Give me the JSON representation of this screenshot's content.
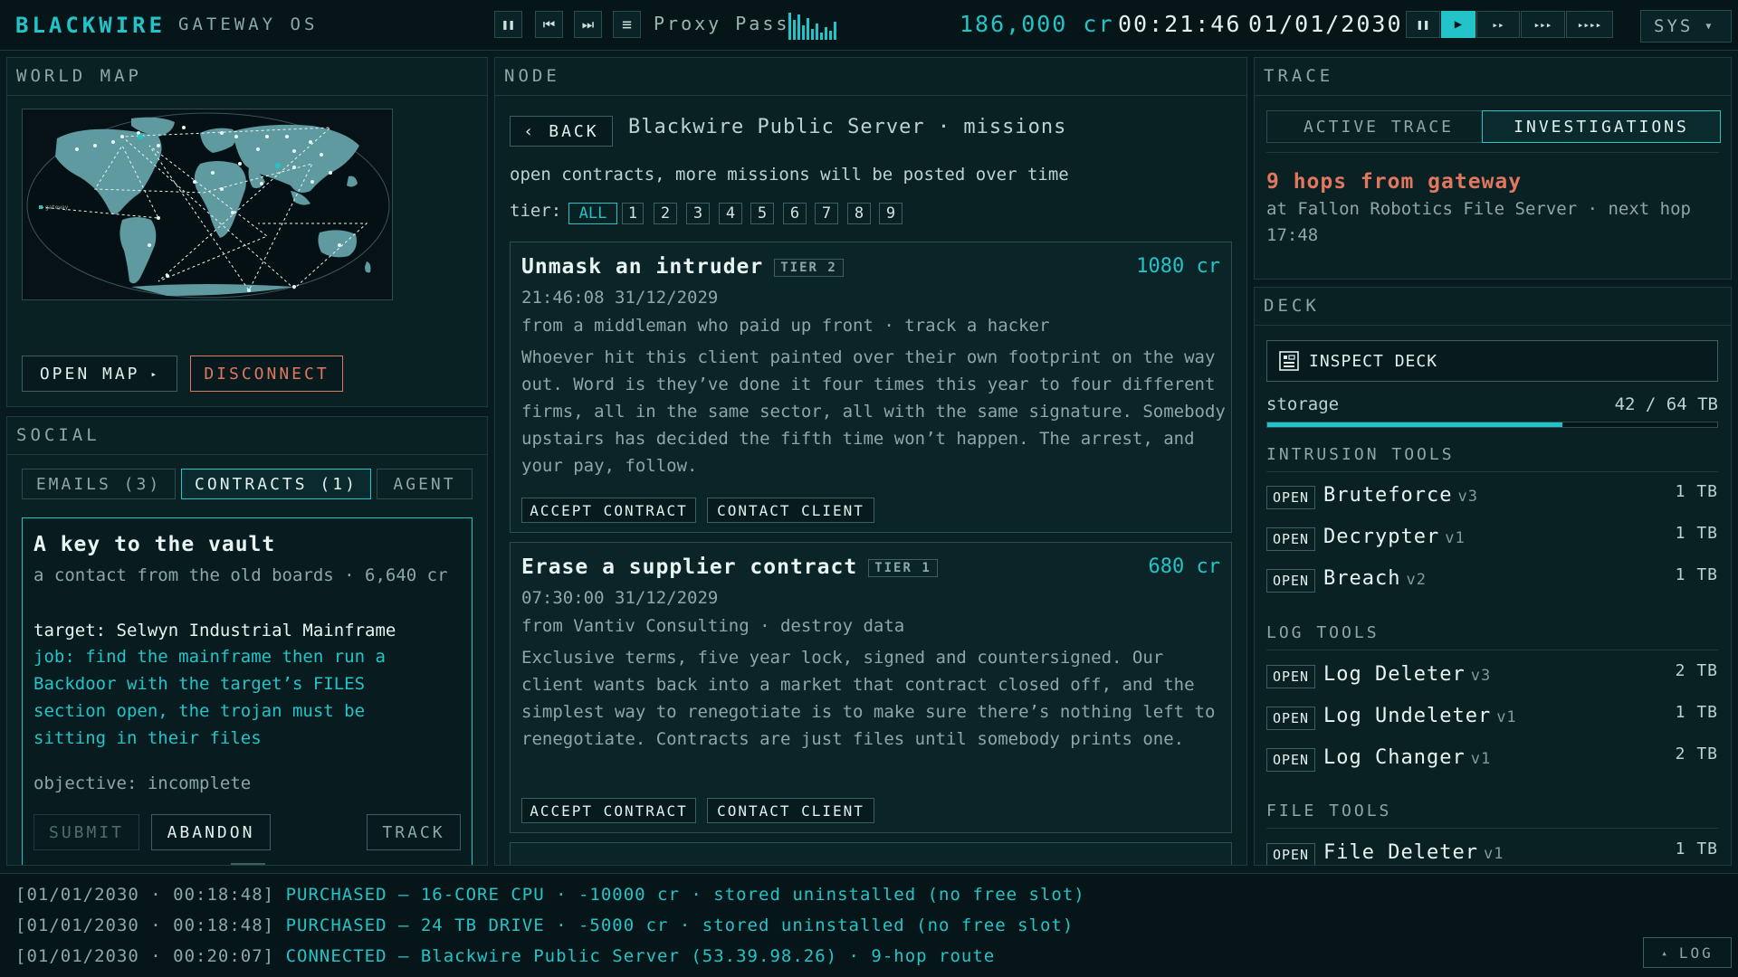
{
  "topbar": {
    "brand": "BLACKWIRE",
    "os": "GATEWAY OS",
    "music_controls": [
      {
        "icon": "pause-icon",
        "glyph": "❚❚"
      },
      {
        "icon": "skip-back-icon",
        "glyph": "⏮"
      },
      {
        "icon": "skip-forward-icon",
        "glyph": "⏭"
      },
      {
        "icon": "playlist-icon",
        "glyph": "≡"
      }
    ],
    "track": "Proxy Pass",
    "credits": "186,000 cr",
    "clock": "00:21:46",
    "date": "01/01/2030",
    "speed": [
      {
        "icon": "pause-icon",
        "glyph": "❚❚",
        "active": false
      },
      {
        "icon": "play-icon",
        "glyph": "▶",
        "active": true
      },
      {
        "icon": "fast-forward-icon",
        "glyph": "▸▸",
        "active": false
      },
      {
        "icon": "faster-icon",
        "glyph": "▸▸▸",
        "active": false
      },
      {
        "icon": "fastest-icon",
        "glyph": "▸▸▸▸",
        "active": false
      }
    ],
    "sys": "SYS"
  },
  "world_map": {
    "title": "WORLD MAP",
    "gateway_label": "gateway",
    "open_map": "OPEN MAP",
    "open_map_arrow": "▸",
    "disconnect": "DISCONNECT"
  },
  "social": {
    "title": "SOCIAL",
    "tabs": [
      "EMAILS (3)",
      "CONTRACTS (1)",
      "AGENT"
    ],
    "active_tab": 1,
    "contract": {
      "title": "A key to the vault",
      "from": "a contact from the old boards · 6,640 cr",
      "target": "target: Selwyn Industrial Mainframe",
      "job": "job: find the mainframe then run a Backdoor with the target’s FILES section open, the trojan must be sitting in their files",
      "objective": "objective: incomplete",
      "submit": "SUBMIT",
      "abandon": "ABANDON",
      "track": "TRACK"
    }
  },
  "node": {
    "title": "NODE",
    "back": "BACK",
    "back_icon": "‹",
    "server": "Blackwire Public Server · missions",
    "intro": "open contracts, more missions will be posted over time",
    "tier_label": "tier:",
    "tiers": [
      "ALL",
      "1",
      "2",
      "3",
      "4",
      "5",
      "6",
      "7",
      "8",
      "9"
    ],
    "missions": [
      {
        "title": "Unmask an intruder",
        "tier": "TIER 2",
        "reward": "1080 cr",
        "time": "21:46:08 31/12/2029",
        "from": "from a middleman who paid up front · track a hacker",
        "body": "Whoever hit this client painted over their own footprint on the way out. Word is they’ve done it four times this year to four different firms, all in the same sector, all with the same signature. Somebody upstairs has decided the fifth time won’t happen. The arrest, and your pay, follow.",
        "accept": "ACCEPT CONTRACT",
        "contact": "CONTACT CLIENT"
      },
      {
        "title": "Erase a supplier contract",
        "tier": "TIER 1",
        "reward": "680 cr",
        "time": "07:30:00 31/12/2029",
        "from": "from Vantiv Consulting · destroy data",
        "body": "Exclusive terms, five year lock, signed and countersigned. Our client wants back into a market that contract closed off, and the simplest way to renegotiate is to make sure there’s nothing left to renegotiate. Contracts are just files until somebody prints one.",
        "accept": "ACCEPT CONTRACT",
        "contact": "CONTACT CLIENT"
      }
    ]
  },
  "trace": {
    "title": "TRACE",
    "tabs": [
      "ACTIVE TRACE",
      "INVESTIGATIONS"
    ],
    "active_tab": 1,
    "hops": "9 hops from gateway",
    "detail": "at Fallon Robotics File Server · next hop 17:48"
  },
  "deck": {
    "title": "DECK",
    "inspect": "INSPECT DECK",
    "storage_label": "storage",
    "storage_value": "42 / 64 TB",
    "storage_fraction": 0.656,
    "sections": [
      {
        "name": "INTRUSION TOOLS",
        "tools": [
          {
            "open": "OPEN",
            "name": "Bruteforce",
            "version": "v3",
            "size": "1 TB"
          },
          {
            "open": "OPEN",
            "name": "Decrypter",
            "version": "v1",
            "size": "1 TB"
          },
          {
            "open": "OPEN",
            "name": "Breach",
            "version": "v2",
            "size": "1 TB"
          }
        ]
      },
      {
        "name": "LOG TOOLS",
        "tools": [
          {
            "open": "OPEN",
            "name": "Log Deleter",
            "version": "v3",
            "size": "2 TB"
          },
          {
            "open": "OPEN",
            "name": "Log Undeleter",
            "version": "v1",
            "size": "1 TB"
          },
          {
            "open": "OPEN",
            "name": "Log Changer",
            "version": "v1",
            "size": "2 TB"
          }
        ]
      },
      {
        "name": "FILE TOOLS",
        "tools": [
          {
            "open": "OPEN",
            "name": "File Deleter",
            "version": "v1",
            "size": "1 TB"
          }
        ]
      }
    ]
  },
  "log": {
    "entries": [
      {
        "ts": "[01/01/2030 · 00:18:48]",
        "msg": "PURCHASED — 16-CORE CPU · -10000 cr · stored uninstalled (no free slot)"
      },
      {
        "ts": "[01/01/2030 · 00:18:48]",
        "msg": "PURCHASED — 24 TB DRIVE · -5000 cr · stored uninstalled (no free slot)"
      },
      {
        "ts": "[01/01/2030 · 00:20:07]",
        "msg": "CONNECTED — Blackwire Public Server (53.39.98.26) · 9-hop route"
      }
    ],
    "toggle": "LOG",
    "toggle_icon": "▴"
  },
  "colors": {
    "accent": "#22c4c9",
    "warn": "#e0775e",
    "bg": "#071a1d"
  }
}
